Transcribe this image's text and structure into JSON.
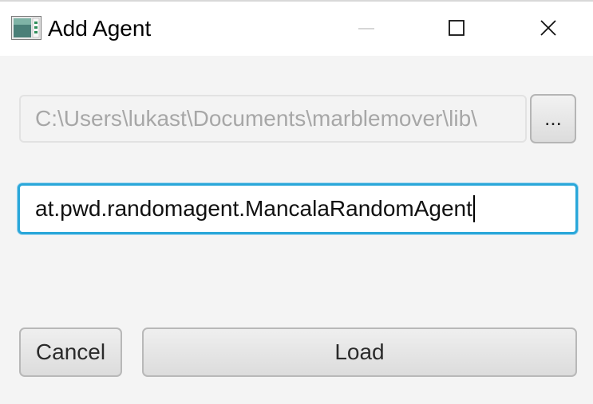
{
  "window": {
    "title": "Add Agent"
  },
  "form": {
    "library_path": "C:\\Users\\lukast\\Documents\\marblemover\\lib\\",
    "browse_label": "...",
    "agent_class": "at.pwd.randomagent.MancalaRandomAgent"
  },
  "actions": {
    "cancel_label": "Cancel",
    "load_label": "Load"
  },
  "colors": {
    "focus_accent": "#2aa7d9",
    "dialog_background": "#f4f4f4",
    "titlebar_background": "#ffffff"
  },
  "icons": {
    "app": "app-icon",
    "minimize": "minimize-icon",
    "maximize": "maximize-icon",
    "close": "close-icon"
  }
}
